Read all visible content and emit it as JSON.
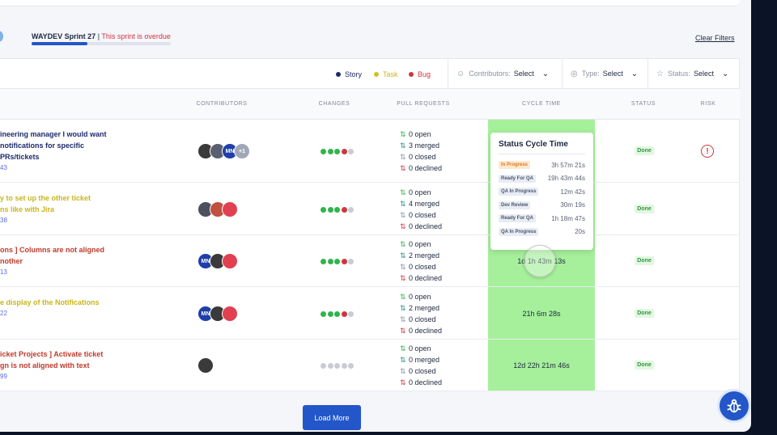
{
  "sprint": {
    "title": "WAYDEV Sprint 27",
    "separator": " | ",
    "overdue_text": "This sprint is overdue",
    "progress": 0.4,
    "clear_filters": "Clear Filters"
  },
  "legend": [
    {
      "label": "Story",
      "color": "#1e2a6e"
    },
    {
      "label": "Task",
      "color": "#d4c020"
    },
    {
      "label": "Bug",
      "color": "#d0353f"
    }
  ],
  "filters": [
    {
      "label": "Contributors:",
      "value": "Select",
      "icon": "person-icon"
    },
    {
      "label": "Type:",
      "value": "Select",
      "icon": "type-icon"
    },
    {
      "label": "Status:",
      "value": "Select",
      "icon": "star-icon"
    }
  ],
  "columns": {
    "contributors": "CONTRIBUTORS",
    "changes": "CHANGES",
    "pull_requests": "PULL REQUESTS",
    "cycle_time": "CYCLE TIME",
    "status": "STATUS",
    "risk": "RISK"
  },
  "rows": [
    {
      "lines": [
        "ineering manager I would want",
        "notifications for specific",
        "PRs/tickets"
      ],
      "num": "43",
      "color": "#1e2a6e",
      "avatars": [
        "#3a3a3a",
        "#5a6070",
        "#1e3fa8",
        "#a0a8b8"
      ],
      "avatar_labels": [
        "",
        "",
        "MN",
        "+1"
      ],
      "changes": [
        "#2fb44a",
        "#2fb44a",
        "#2fb44a",
        "#d0353f",
        "#c8ccd4"
      ],
      "prs": {
        "open": "0 open",
        "merged": "3 merged",
        "closed": "0 closed",
        "declined": "0 declined"
      },
      "cycle": "",
      "status": "Done",
      "risk": "!"
    },
    {
      "lines": [
        "y to set up the other ticket",
        "ns like with Jira"
      ],
      "num": "38",
      "color": "#c9b51c",
      "avatars": [
        "#4a5060",
        "#c05040",
        "#e04050"
      ],
      "avatar_labels": [
        "",
        "",
        ""
      ],
      "changes": [
        "#2fb44a",
        "#2fb44a",
        "#2fb44a",
        "#d0353f",
        "#c8ccd4"
      ],
      "prs": {
        "open": "0 open",
        "merged": "4 merged",
        "closed": "0 closed",
        "declined": "0 declined"
      },
      "cycle": "",
      "status": "Done",
      "risk": ""
    },
    {
      "lines": [
        "ons ] Columns are not aligned",
        "nother"
      ],
      "num": "13",
      "color": "#c0392b",
      "avatars": [
        "#1e3fa8",
        "#3a3a3a",
        "#e04050"
      ],
      "avatar_labels": [
        "MN",
        "",
        ""
      ],
      "changes": [
        "#2fb44a",
        "#2fb44a",
        "#2fb44a",
        "#d0353f",
        "#c8ccd4"
      ],
      "prs": {
        "open": "0 open",
        "merged": "2 merged",
        "closed": "0 closed",
        "declined": "0 declined"
      },
      "cycle": "1d 1h 43m 13s",
      "status": "Done",
      "risk": ""
    },
    {
      "lines": [
        "e display of the Notifications",
        ""
      ],
      "num": "22",
      "color": "#c9b51c",
      "avatars": [
        "#1e3fa8",
        "#3a3a3a",
        "#e04050"
      ],
      "avatar_labels": [
        "MN",
        "",
        ""
      ],
      "changes": [
        "#2fb44a",
        "#2fb44a",
        "#2fb44a",
        "#d0353f",
        "#c8ccd4"
      ],
      "prs": {
        "open": "0 open",
        "merged": "2 merged",
        "closed": "0 closed",
        "declined": "0 declined"
      },
      "cycle": "21h 6m 28s",
      "status": "Done",
      "risk": ""
    },
    {
      "lines": [
        "icket Projects ] Activate ticket",
        "gn is not aligned with text"
      ],
      "num": "99",
      "color": "#c0392b",
      "avatars": [
        "#3a3a3a"
      ],
      "avatar_labels": [
        ""
      ],
      "changes": [
        "#c8ccd4",
        "#c8ccd4",
        "#c8ccd4",
        "#c8ccd4",
        "#c8ccd4"
      ],
      "prs": {
        "open": "0 open",
        "merged": "0 merged",
        "closed": "0 closed",
        "declined": "0 declined"
      },
      "cycle": "12d 22h 21m 46s",
      "status": "Done",
      "risk": ""
    }
  ],
  "tooltip": {
    "title": "Status Cycle Time",
    "entries": [
      {
        "label": "In Progress",
        "value": "3h 57m 21s",
        "bg": "#fde9d2",
        "fg": "#e07a1a"
      },
      {
        "label": "Ready For QA",
        "value": "19h 43m 44s",
        "bg": "#e8ecf3",
        "fg": "#4a5670"
      },
      {
        "label": "QA In Progress",
        "value": "12m 42s",
        "bg": "#e8ecf3",
        "fg": "#4a5670"
      },
      {
        "label": "Dev Review",
        "value": "30m 19s",
        "bg": "#e8ecf3",
        "fg": "#4a5670"
      },
      {
        "label": "Ready For QA",
        "value": "1h 18m 47s",
        "bg": "#e8ecf3",
        "fg": "#4a5670"
      },
      {
        "label": "QA In Progress",
        "value": "20s",
        "bg": "#e8ecf3",
        "fg": "#4a5670"
      }
    ]
  },
  "load_more": "Load More"
}
